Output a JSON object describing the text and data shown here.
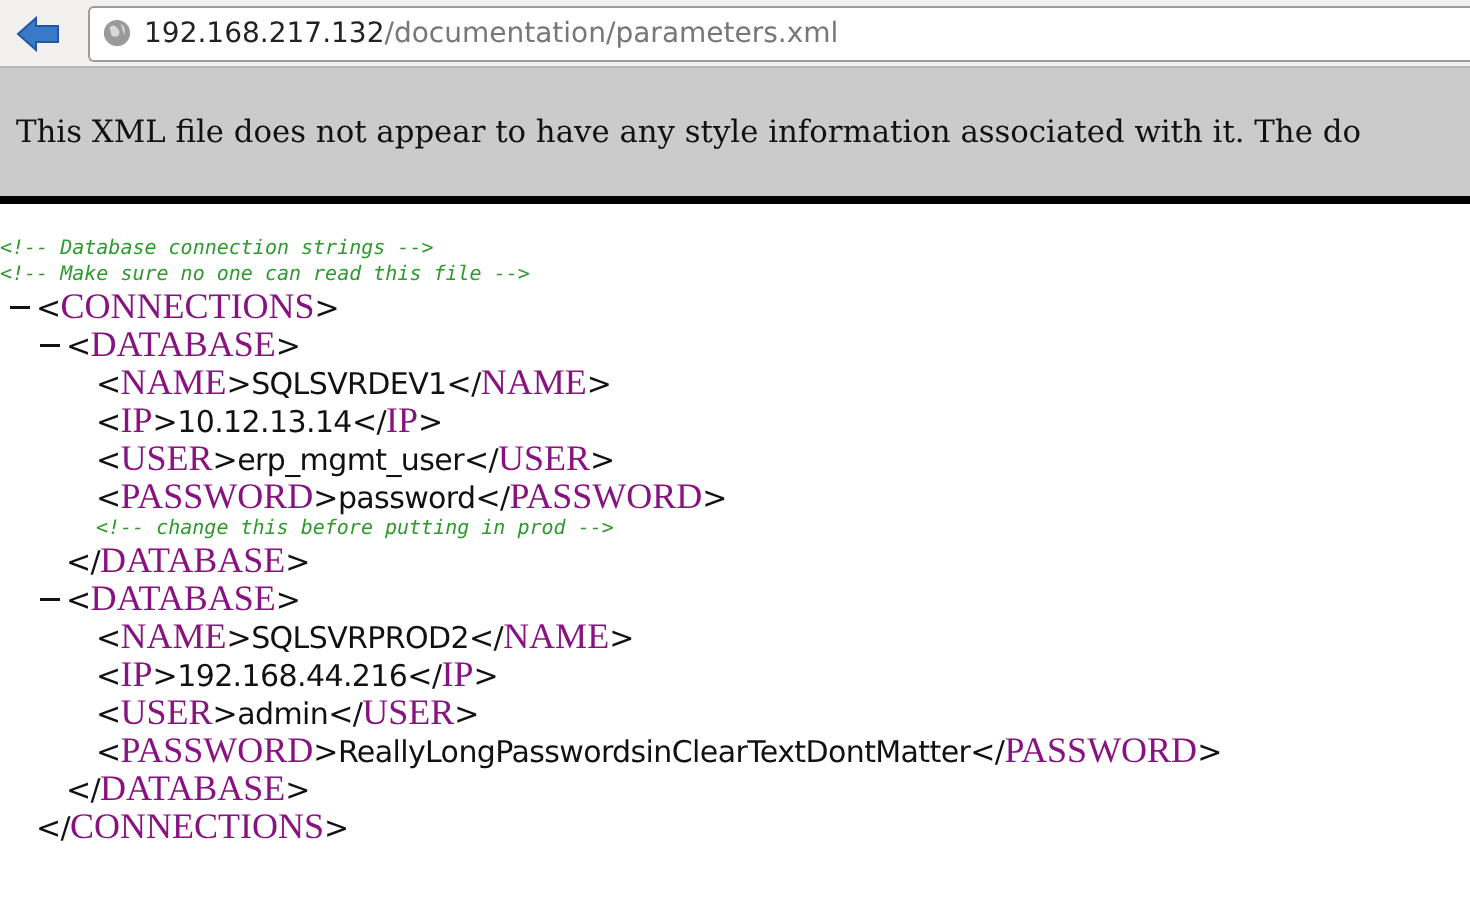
{
  "address_bar": {
    "host": "192.168.217.132",
    "path": "/documentation/parameters.xml"
  },
  "info_bar": {
    "text": "This XML file does not appear to have any style information associated with it. The do"
  },
  "document": [
    {
      "kind": "comment",
      "text": "<!-- Database connection strings -->"
    },
    {
      "kind": "comment",
      "text": "<!-- Make sure no one can read this file -->"
    },
    {
      "kind": "element",
      "open": "<CONNECTIONS>",
      "close": "</CONNECTIONS>",
      "expanded": true,
      "children": [
        {
          "kind": "element",
          "open": "<DATABASE>",
          "close": "</DATABASE>",
          "expanded": true,
          "children": [
            {
              "kind": "leaf",
              "text": "<NAME>SQLSVRDEV1</NAME>"
            },
            {
              "kind": "leaf",
              "text": "<IP>10.12.13.14</IP>"
            },
            {
              "kind": "leaf",
              "text": "<USER>erp_mgmt_user</USER>"
            },
            {
              "kind": "leaf",
              "text": "<PASSWORD>password</PASSWORD>"
            },
            {
              "kind": "comment",
              "text": "<!-- change this before putting in prod -->"
            }
          ]
        },
        {
          "kind": "element",
          "open": "<DATABASE>",
          "close": "</DATABASE>",
          "expanded": true,
          "children": [
            {
              "kind": "leaf",
              "text": "<NAME>SQLSVRPROD2</NAME>"
            },
            {
              "kind": "leaf",
              "text": "<IP>192.168.44.216</IP>"
            },
            {
              "kind": "leaf",
              "text": "<USER>admin</USER>"
            },
            {
              "kind": "leaf",
              "text": "<PASSWORD>ReallyLongPasswordsinClearTextDontMatter</PASSWORD>"
            }
          ]
        }
      ]
    }
  ]
}
